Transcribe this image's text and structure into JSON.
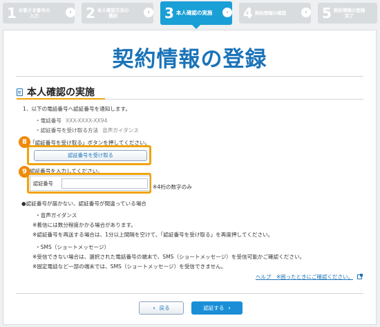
{
  "steps": [
    {
      "num": "1",
      "label_l1": "お客さま番号の",
      "label_l2": "入力",
      "active": false
    },
    {
      "num": "2",
      "label_l1": "本人確認方法の",
      "label_l2": "選択",
      "active": false
    },
    {
      "num": "3",
      "label_l1": "本人確認の実施",
      "label_l2": "",
      "active": true
    },
    {
      "num": "4",
      "label_l1": "契約情報の確認",
      "label_l2": "",
      "active": false
    },
    {
      "num": "5",
      "label_l1": "契約情報の登録",
      "label_l2": "完了",
      "active": false
    }
  ],
  "step_separator": "›",
  "page_title": "契約情報の登録",
  "section_title": "本人確認の実施",
  "body": {
    "item1": "1．以下の電話番号へ認証番号を通知します。",
    "phone_label": "・電話番号",
    "phone_value": "XXX-XXXX-XX94",
    "method_label": "・認証番号を受け取る方法",
    "method_value": "音声ガイダンス",
    "press_instruction": "「認証番号を受け取る」ボタンを押してください。",
    "receive_button": "認証番号を受け取る",
    "enter_instruction": "認証番号を入力してください。",
    "code_label": "認証番号",
    "code_value": "",
    "code_note": "※4桁の数字のみ",
    "trouble_heading": "●認証番号が届かない、認証番号が間違っている場合",
    "voice_heading": "・音声ガイダンス",
    "voice_note1": "※着信には数分程度かかる場合があります。",
    "voice_note2": "※認証番号を再送する場合は、1分以上間隔を空けて、「認証番号を受け取る」を再度押してください。",
    "sms_heading": "・SMS（ショートメッセージ）",
    "sms_note1": "※受信できない場合は、選択された電話番号の端末で、SMS（ショートメッセージ）を受信可能かご確認ください。",
    "sms_note2": "※固定電話など一部の端末では、SMS（ショートメッセージ）を受信できません。"
  },
  "help_link": "ヘルプ　※困ったときにご確認ください。",
  "badges": {
    "first": "8",
    "second": "9"
  },
  "buttons": {
    "back": "戻る",
    "next": "認証する",
    "back_icon": "‹",
    "next_icon": "›"
  },
  "colors": {
    "accent": "#1a73b8",
    "highlight": "#f0a30a",
    "active_step": "#1a9fd6"
  }
}
